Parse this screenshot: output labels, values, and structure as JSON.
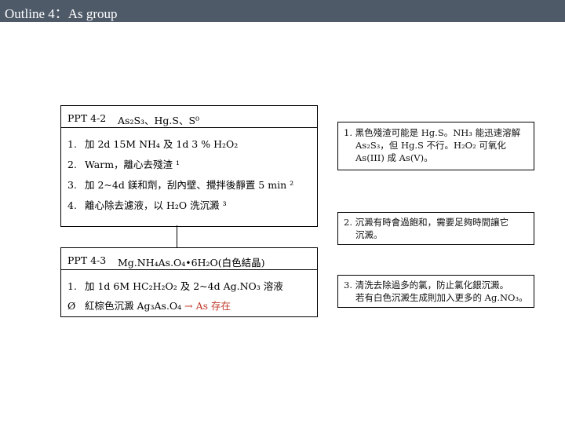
{
  "title": "Outline 4：As group",
  "box1": {
    "code": "PPT 4-2",
    "chemical": "As₂S₃、Hg.S、S⁰",
    "steps": [
      {
        "num": "1.",
        "text": "加 2d 15M NH₄ 及 1d 3 % H₂O₂"
      },
      {
        "num": "2.",
        "text": "Warm，離心去殘渣 ¹"
      },
      {
        "num": "3.",
        "text": "加 2~4d 鎂和劑，刮內壁、攪拌後靜置 5 min ²"
      },
      {
        "num": "4.",
        "text": "離心除去濾液，以 H₂O 洗沉澱 ³"
      }
    ]
  },
  "box2": {
    "code": "PPT 4-3",
    "chemical": "Mg.NH₄As.O₄•6H₂O(白色結晶)",
    "steps": [
      {
        "num": "1.",
        "text": "加 1d 6M HC₂H₂O₂ 及 2~4d Ag.NO₃ 溶液"
      },
      {
        "num": "Ø",
        "text_before": "紅棕色沉澱 Ag₃As.O₄ ",
        "text_red": "→ As 存在"
      }
    ]
  },
  "notes": [
    {
      "lines": [
        "1. 黑色殘渣可能是 Hg.S。NH₃ 能迅速溶解",
        "As₂S₃，但 Hg.S 不行。H₂O₂ 可氧化",
        "As(III) 成 As(V)。"
      ]
    },
    {
      "lines": [
        "2. 沉澱有時會過飽和，需要足夠時間讓它",
        "沉澱。"
      ]
    },
    {
      "lines": [
        "3. 清洗去除過多的氯，防止氯化銀沉澱。",
        "若有白色沉澱生成則加入更多的 Ag.NO₃。"
      ]
    }
  ],
  "colors": {
    "titlebar": "#4f5a69",
    "accent_red": "#c0392b"
  }
}
